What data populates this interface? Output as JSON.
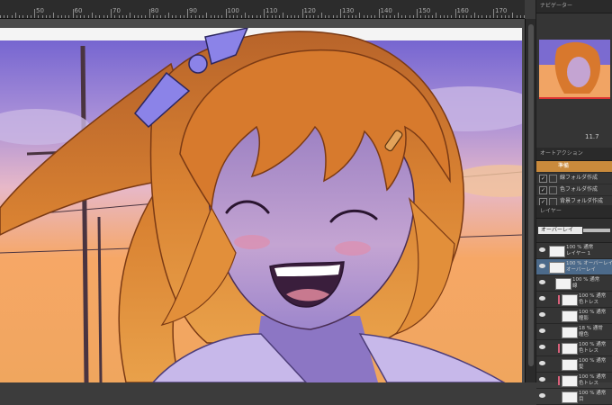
{
  "ruler": {
    "labels": [
      "50",
      "60",
      "70",
      "80",
      "90",
      "100",
      "110",
      "120",
      "130",
      "140",
      "150",
      "160",
      "170",
      "180"
    ]
  },
  "panel": {
    "navigator_tab": "ナビゲーター",
    "zoom": "11.7",
    "autoaction_tab": "オートアクション",
    "autoaction_header": "準備",
    "autoaction_items": [
      {
        "label": "線フォルダ作成"
      },
      {
        "label": "色フォルダ作成"
      },
      {
        "label": "背景フォルダ作成"
      }
    ],
    "layer_tab": "レイヤー",
    "blend_mode": "オーバーレイ",
    "layers": [
      {
        "line1": "100 % 通常",
        "line2": "レイヤー 1",
        "indent": 0,
        "selected": false,
        "clip": false
      },
      {
        "line1": "100 % オーバーレイ",
        "line2": "オーバーレイ",
        "indent": 0,
        "selected": true,
        "clip": false
      },
      {
        "line1": "100 % 通常",
        "line2": "線",
        "indent": 1,
        "selected": false,
        "clip": false
      },
      {
        "line1": "100 % 通常",
        "line2": "色トレス",
        "indent": 2,
        "selected": false,
        "clip": true
      },
      {
        "line1": "100 % 通常",
        "line2": "瞳影",
        "indent": 2,
        "selected": false,
        "clip": false
      },
      {
        "line1": "18 % 通常",
        "line2": "瞳色",
        "indent": 2,
        "selected": false,
        "clip": false
      },
      {
        "line1": "100 % 通常",
        "line2": "色トレス",
        "indent": 2,
        "selected": false,
        "clip": true
      },
      {
        "line1": "100 % 通常",
        "line2": "髪",
        "indent": 2,
        "selected": false,
        "clip": false
      },
      {
        "line1": "100 % 通常",
        "line2": "色トレス",
        "indent": 2,
        "selected": false,
        "clip": true
      },
      {
        "line1": "100 % 通常",
        "line2": "目",
        "indent": 2,
        "selected": false,
        "clip": false
      }
    ]
  },
  "colors": {
    "sky_top": "#7d6fd6",
    "sky_mid": "#b79ad8",
    "sky_low": "#f3a46a",
    "hair": "#d7772c",
    "hair_dark": "#7b3a14",
    "skin": "#bfa0d0",
    "bow": "#8b83e8",
    "accent_orange": "#c98a3c",
    "selected_layer": "#4c6a8a"
  }
}
